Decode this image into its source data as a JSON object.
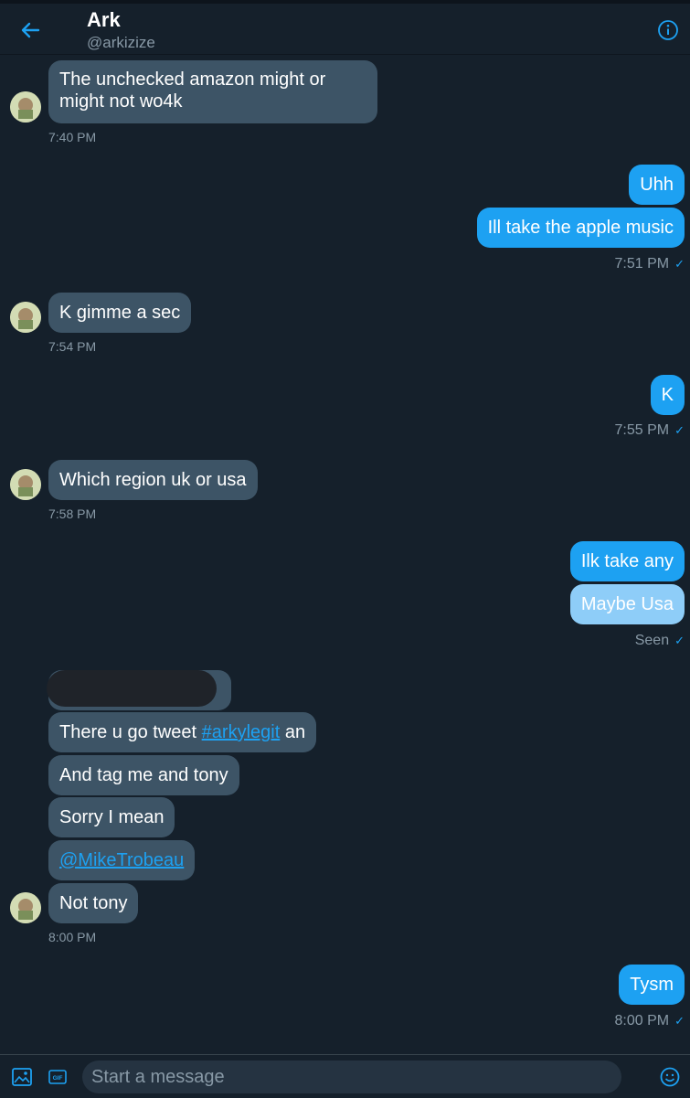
{
  "header": {
    "name": "Ark",
    "handle": "@arkizize",
    "back_icon": "arrow-left-icon",
    "info_icon": "info-icon"
  },
  "messages": [
    {
      "dir": "in",
      "lines": [
        "The unchecked amazon might or",
        "might not wo4k"
      ]
    },
    {
      "dir": "in",
      "time": "7:40 PM"
    },
    {
      "dir": "out",
      "text": "Uhh"
    },
    {
      "dir": "out",
      "text": "Ill take the apple music"
    },
    {
      "dir": "out",
      "time": "7:51 PM"
    },
    {
      "dir": "in",
      "text": "K gimme a sec"
    },
    {
      "dir": "in",
      "time": "7:54 PM"
    },
    {
      "dir": "out",
      "text": "K"
    },
    {
      "dir": "out",
      "time": "7:55 PM"
    },
    {
      "dir": "in",
      "text": "Which region uk or usa"
    },
    {
      "dir": "in",
      "time": "7:58 PM"
    },
    {
      "dir": "out",
      "text": "Ilk take any"
    },
    {
      "dir": "out",
      "text": "Maybe Usa"
    },
    {
      "dir": "out",
      "status": "Seen"
    },
    {
      "dir": "in",
      "text_before": "There u go tweet ",
      "hashtag": "#arkylegit",
      "text_after": " an"
    },
    {
      "dir": "in",
      "text": "And tag me and tony"
    },
    {
      "dir": "in",
      "text": "Sorry I mean"
    },
    {
      "dir": "in",
      "mention": "@MikeTrobeau"
    },
    {
      "dir": "in",
      "text": "Not tony"
    },
    {
      "dir": "in",
      "time": "8:00 PM"
    },
    {
      "dir": "out",
      "text": "Tysm"
    },
    {
      "dir": "out",
      "time": "8:00 PM"
    }
  ],
  "composer": {
    "placeholder": "Start a message",
    "gif_label": "GIF",
    "image_icon": "image-icon",
    "emoji_icon": "emoji-icon"
  },
  "colors": {
    "background": "#15202b",
    "incoming_bubble": "#3d5466",
    "outgoing_bubble": "#1da1f2",
    "accent": "#1da1f2"
  }
}
